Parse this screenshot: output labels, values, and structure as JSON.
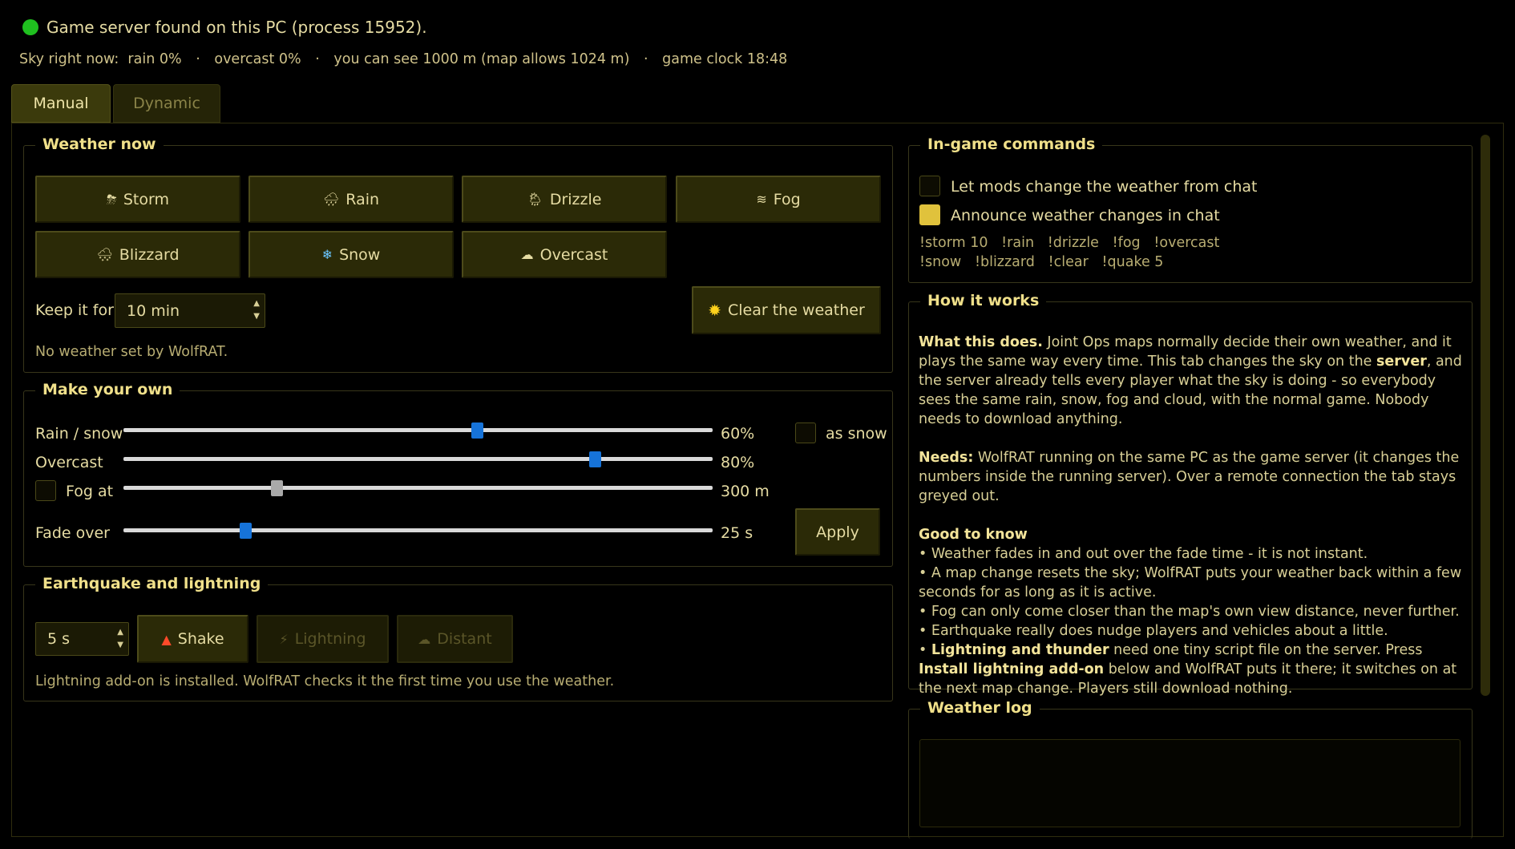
{
  "status": {
    "text": "Game server found on this PC (process 15952).",
    "dot_color": "#1fc01f"
  },
  "sky": {
    "prefix": "Sky right now:",
    "rain": "rain 0%",
    "overcast": "overcast 0%",
    "visibility": "you can see 1000 m (map allows 1024 m)",
    "clock": "game clock 18:48",
    "separator": "·"
  },
  "tabs": {
    "manual": "Manual",
    "dynamic": "Dynamic"
  },
  "weather_now": {
    "title": "Weather now",
    "presets": [
      {
        "label": "Storm",
        "icon": "storm-cloud-icon",
        "glyph": "⛈"
      },
      {
        "label": "Rain",
        "icon": "rain-cloud-icon",
        "glyph": "🌧"
      },
      {
        "label": "Drizzle",
        "icon": "drizzle-icon",
        "glyph": "🌦"
      },
      {
        "label": "Fog",
        "icon": "fog-icon",
        "glyph": "≋"
      },
      {
        "label": "Blizzard",
        "icon": "blizzard-icon",
        "glyph": "🌨"
      },
      {
        "label": "Snow",
        "icon": "snowflake-icon",
        "glyph": "❄"
      },
      {
        "label": "Overcast",
        "icon": "cloud-icon",
        "glyph": "☁"
      }
    ],
    "keep_label": "Keep it for",
    "keep_value": "10 min",
    "clear_label": "Clear the weather",
    "clear_glyph": "✹",
    "note": "No weather set by WolfRAT."
  },
  "make_your_own": {
    "title": "Make your own",
    "rain_label": "Rain / snow",
    "rain_value": "60%",
    "rain_level": 0.6,
    "as_snow_label": "as snow",
    "overcast_label": "Overcast",
    "overcast_value": "80%",
    "overcast_level": 0.8,
    "fog_label": "Fog at",
    "fog_value": "300 m",
    "fade_label": "Fade over",
    "fade_value": "25 s",
    "apply_label": "Apply"
  },
  "quake": {
    "title": "Earthquake and lightning",
    "duration": "5 s",
    "shake_label": "Shake",
    "lightning_label": "Lightning",
    "distant_label": "Distant",
    "note": "Lightning add-on is installed. WolfRAT checks it the first time you use the weather."
  },
  "commands": {
    "title": "In-game commands",
    "mods_label": "Let mods change the weather from chat",
    "mods_checked": false,
    "announce_label": "Announce weather changes in chat",
    "announce_checked": true,
    "line1": [
      "!storm 10",
      "!rain",
      "!drizzle",
      "!fog",
      "!overcast"
    ],
    "line2": [
      "!snow",
      "!blizzard",
      "!clear",
      "!quake 5"
    ]
  },
  "how": {
    "title": "How it works",
    "p1_bold": "What this does.",
    "p1_a": " Joint Ops maps normally decide their own weather, and it plays the same way every time. This tab changes the sky on the ",
    "p1_server": "server",
    "p1_b": ", and the server already tells every player what the sky is doing - so everybody sees the same rain, snow, fog and cloud, with the normal game. Nobody needs to download anything.",
    "p2_bold": "Needs:",
    "p2": " WolfRAT running on the same PC as the game server (it changes the numbers inside the running server). Over a remote connection the tab stays greyed out.",
    "p3_bold": "Good to know",
    "b1": "• Weather fades in and out over the fade time - it is not instant.",
    "b2": "• A map change resets the sky; WolfRAT puts your weather back within a few seconds for as long as it is active.",
    "b3": "• Fog can only come closer than the map's own view distance, never further.",
    "b4": "• Earthquake really does nudge players and vehicles about a little.",
    "b5_pre": "• ",
    "b5_bold": "Lightning and thunder",
    "b5_a": " need one tiny script file on the server. Press ",
    "b5_bold2": "Install lightning add-on",
    "b5_b": " below and WolfRAT puts it there; it switches on at the next map change. Players still download nothing."
  },
  "log": {
    "title": "Weather log"
  }
}
